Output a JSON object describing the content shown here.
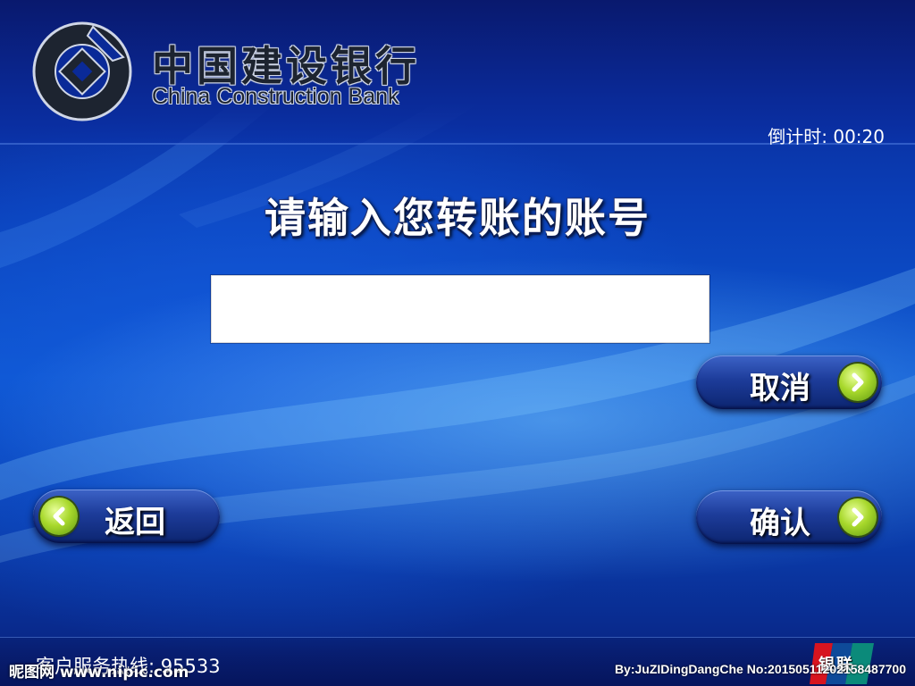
{
  "header": {
    "bank_name_cn": "中国建设银行",
    "bank_name_en": "China Construction Bank",
    "countdown_label": "倒计时: 00:20"
  },
  "main": {
    "prompt": "请输入您转账的账号",
    "account_input": {
      "value": "",
      "placeholder": ""
    }
  },
  "buttons": {
    "cancel_label": "取消",
    "back_label": "返回",
    "confirm_label": "确认"
  },
  "footer": {
    "hotline": "客户服务热线: 95533",
    "unionpay": "银联",
    "watermark_left": "昵图网 www.nipic.com",
    "watermark_right": "By:JuZIDingDangChe No:20150511202158487700"
  },
  "colors": {
    "background": "#0a3fb8",
    "button": "#1d3c9a",
    "button_icon": "#a8d82c",
    "text": "#ffffff"
  },
  "icons": {
    "logo": "ccb-logo-icon",
    "button_arrow_right": "chevron-right-icon",
    "button_arrow_left": "chevron-left-icon",
    "unionpay": "unionpay-logo-icon"
  }
}
